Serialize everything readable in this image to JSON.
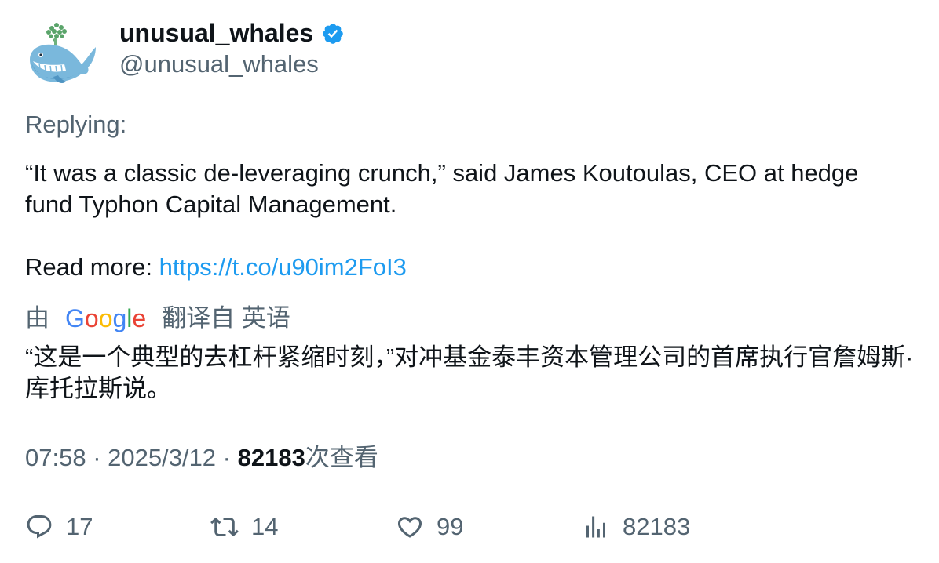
{
  "author": {
    "name": "unusual_whales",
    "handle": "@unusual_whales",
    "verified_color": "#1d9bf0"
  },
  "tweet": {
    "replying_label": "Replying:",
    "text_line1": "“It was a classic de-leveraging crunch,” said James Koutoulas, CEO at hedge fund Typhon Capital Management.",
    "read_more_label": "Read more: ",
    "link_text": "https://t.co/u90im2FoI3",
    "translation": {
      "prefix": "由",
      "provider": "Google",
      "suffix": "翻译自 英语",
      "text": "“这是一个典型的去杠杆紧缩时刻，”对冲基金泰丰资本管理公司的首席执行官詹姆斯·库托拉斯说。"
    }
  },
  "meta": {
    "time": "07:58",
    "separator": " · ",
    "date": "2025/3/12",
    "views_count": "82183",
    "views_label": "次查看"
  },
  "actions": {
    "replies": "17",
    "retweets": "14",
    "likes": "99",
    "views": "82183"
  },
  "colors": {
    "accent": "#1d9bf0",
    "secondary_text": "#536471",
    "primary_text": "#0f1419"
  },
  "icons": [
    "whale-avatar",
    "verified-badge-icon",
    "reply-icon",
    "retweet-icon",
    "like-icon",
    "views-icon"
  ]
}
